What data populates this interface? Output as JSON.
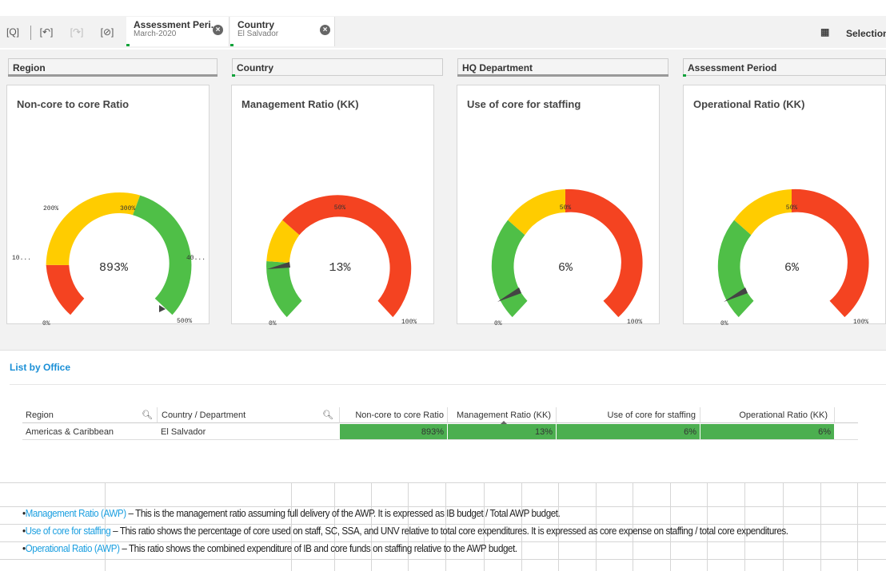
{
  "toolbar": {
    "selections_label": "Selections",
    "chips": [
      {
        "title": "Assessment Peri...",
        "value": "March-2020"
      },
      {
        "title": "Country",
        "value": "El Salvador"
      }
    ]
  },
  "filters": [
    "Region",
    "Country",
    "HQ Department",
    "Assessment Period"
  ],
  "gauges": [
    {
      "title": "Non-core to core Ratio",
      "value_label": "893%",
      "value": 8.93,
      "ticks": [
        "0%",
        "10...",
        "200%",
        "300%",
        "40...",
        "500%"
      ]
    },
    {
      "title": "Management Ratio (KK)",
      "value_label": "13%",
      "value": 0.13,
      "ticks": [
        "0%",
        "50%",
        "100%"
      ]
    },
    {
      "title": "Use of core for staffing",
      "value_label": "6%",
      "value": 0.06,
      "ticks": [
        "0%",
        "50%",
        "100%"
      ]
    },
    {
      "title": "Operational Ratio (KK)",
      "value_label": "6%",
      "value": 0.06,
      "ticks": [
        "0%",
        "50%",
        "100%"
      ]
    }
  ],
  "colors": {
    "green": "#4fbf47",
    "yellow": "#ffcc00",
    "red": "#f44321",
    "accent": "#1a8fd6"
  },
  "list": {
    "title": "List by Office",
    "headers": [
      "Region",
      "Country / Department",
      "Non-core to core Ratio",
      "Management Ratio (KK)",
      "Use of core for staffing",
      "Operational Ratio (KK)"
    ],
    "rows": [
      [
        "Americas & Caribbean",
        "El Salvador",
        "893%",
        "13%",
        "6%",
        "6%"
      ]
    ]
  },
  "notes": [
    {
      "term": "Management Ratio (AWP)",
      "text": " – This is the management ratio assuming full delivery of the AWP. It is expressed as IB budget / Total AWP budget."
    },
    {
      "term": "Use of core for staffing",
      "text": " – This ratio shows the percentage of core used on staff, SC, SSA, and UNV relative to total core expenditures. It is expressed as core expense on staffing / total core expenditures."
    },
    {
      "term": "Operational Ratio (AWP)",
      "text": " – This ratio shows the combined expenditure of IB and core funds on staffing relative to the AWP budget."
    }
  ]
}
